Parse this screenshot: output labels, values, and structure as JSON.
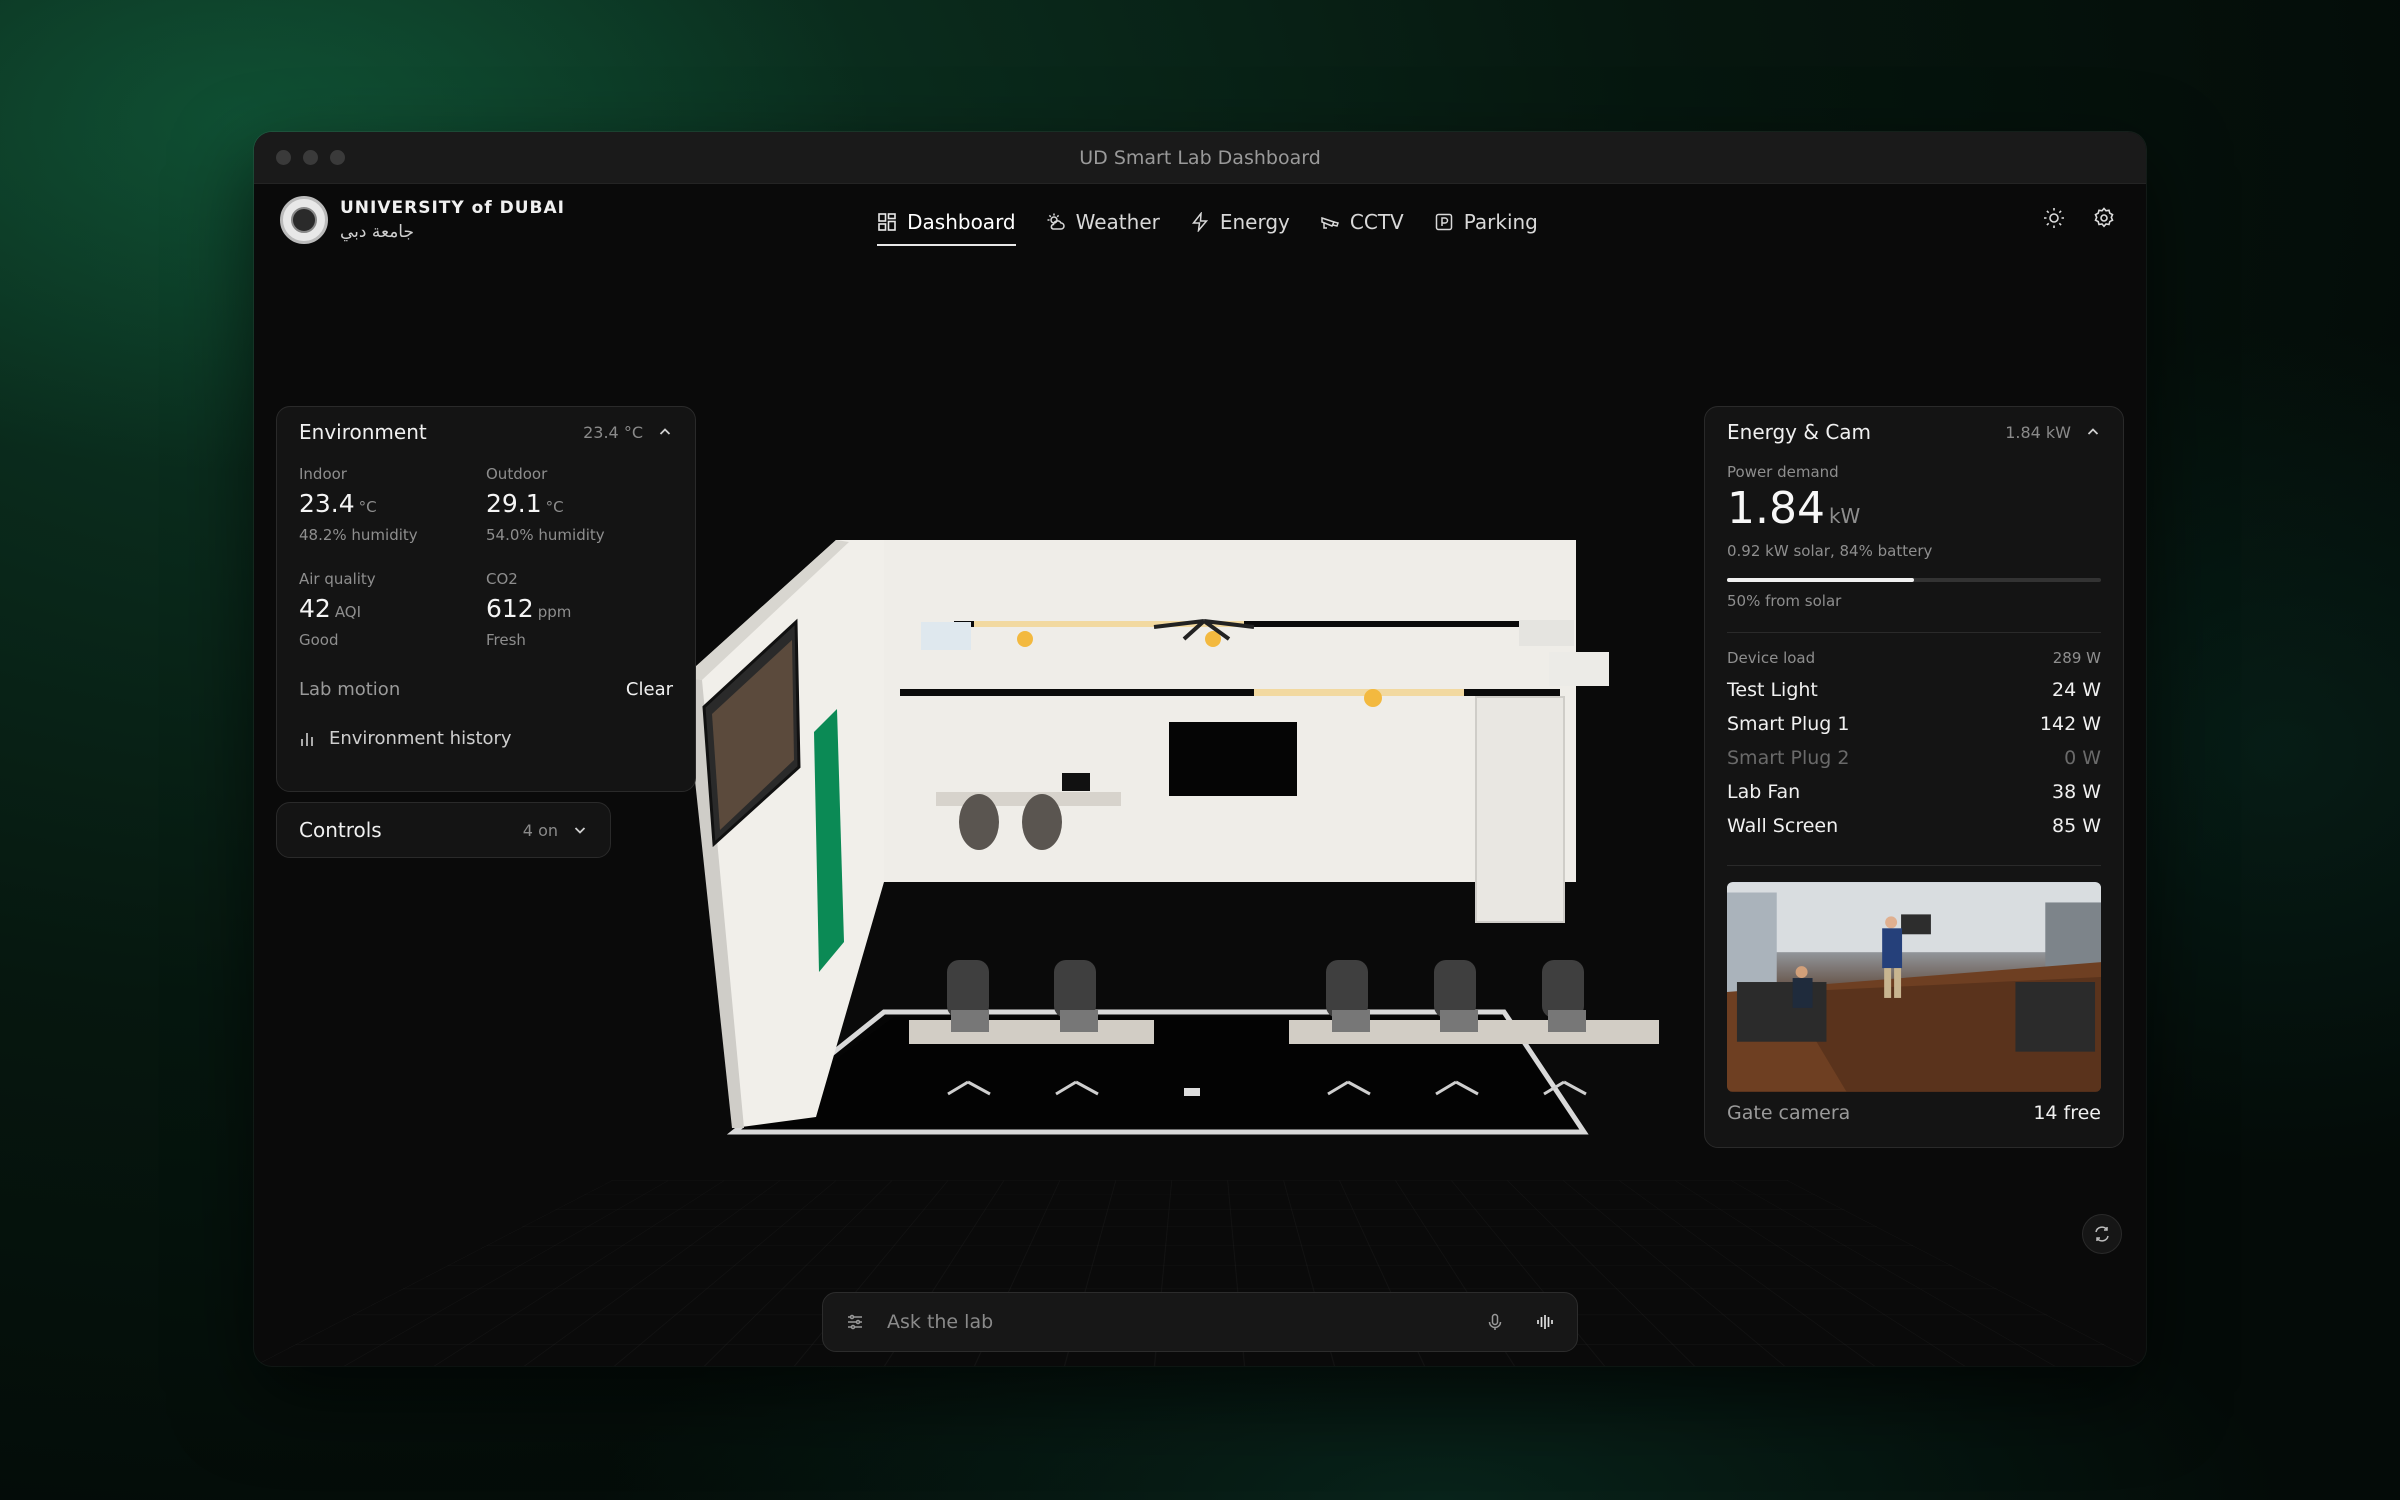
{
  "window": {
    "title": "UD Smart Lab Dashboard"
  },
  "brand": {
    "name": "UNIVERSITY of DUBAI",
    "name_ar": "جامعة دبي"
  },
  "nav": [
    {
      "label": "Dashboard",
      "icon": "dashboard-icon",
      "active": true
    },
    {
      "label": "Weather",
      "icon": "weather-icon",
      "active": false
    },
    {
      "label": "Energy",
      "icon": "lightning-icon",
      "active": false
    },
    {
      "label": "CCTV",
      "icon": "camera-icon",
      "active": false
    },
    {
      "label": "Parking",
      "icon": "parking-icon",
      "active": false
    }
  ],
  "environment": {
    "title": "Environment",
    "summary": "23.4 °C",
    "indoor": {
      "label": "Indoor",
      "value": "23.4",
      "unit": "°C",
      "sub": "48.2% humidity"
    },
    "outdoor": {
      "label": "Outdoor",
      "value": "29.1",
      "unit": "°C",
      "sub": "54.0% humidity"
    },
    "air": {
      "label": "Air quality",
      "value": "42",
      "unit": "AQI",
      "sub": "Good"
    },
    "co2": {
      "label": "CO2",
      "value": "612",
      "unit": "ppm",
      "sub": "Fresh"
    },
    "motion": {
      "label": "Lab motion",
      "value": "Clear"
    },
    "history_label": "Environment history"
  },
  "controls": {
    "title": "Controls",
    "summary": "4 on"
  },
  "energy": {
    "title": "Energy & Cam",
    "summary": "1.84 kW",
    "power_label": "Power demand",
    "power_value": "1.84",
    "power_unit": "kW",
    "power_sub": "0.92 kW solar, 84% battery",
    "solar_fraction": 0.5,
    "solar_label": "50% from solar",
    "device_load_label": "Device load",
    "device_load_total": "289 W",
    "devices": [
      {
        "name": "Test Light",
        "value": "24 W",
        "active": true
      },
      {
        "name": "Smart Plug 1",
        "value": "142 W",
        "active": true
      },
      {
        "name": "Smart Plug 2",
        "value": "0 W",
        "active": false
      },
      {
        "name": "Lab Fan",
        "value": "38 W",
        "active": true
      },
      {
        "name": "Wall Screen",
        "value": "85 W",
        "active": true
      }
    ],
    "camera_label": "Gate camera",
    "camera_value": "14 free"
  },
  "ask": {
    "placeholder": "Ask the lab"
  }
}
